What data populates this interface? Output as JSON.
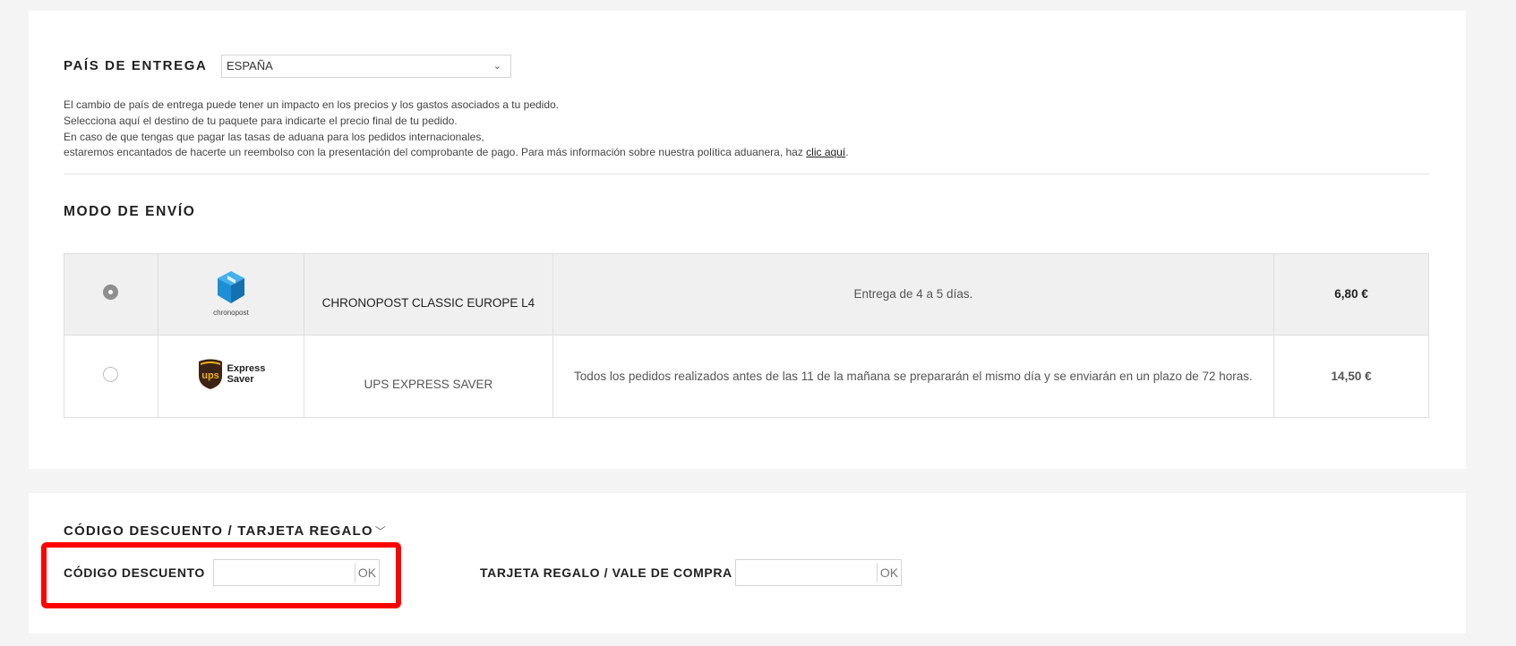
{
  "delivery": {
    "country_label": "PAÍS DE ENTREGA",
    "country_value": "ESPAÑA",
    "info_lines": [
      "El cambio de país de entrega puede tener un impacto en los precios y los gastos asociados a tu pedido.",
      "Selecciona aquí el destino de tu paquete para indicarte el precio final de tu pedido.",
      "En caso de que tengas que pagar las tasas de aduana para los pedidos internacionales,",
      "estaremos encantados de hacerte un reembolso con la presentación del comprobante de pago. Para más información sobre nuestra política aduanera, haz "
    ],
    "info_link": "clic aquí",
    "info_period": "."
  },
  "shipping": {
    "title": "MODO DE ENVÍO",
    "options": [
      {
        "logo_text": "chronopost",
        "name": "CHRONOPOST CLASSIC EUROPE L4",
        "description": "Entrega de 4 a 5 días.",
        "price": "6,80 €",
        "selected": true
      },
      {
        "logo_text_1": "Express",
        "logo_text_2": "Saver",
        "logo_badge": "ups",
        "name": "UPS EXPRESS SAVER",
        "description": "Todos los pedidos realizados antes de las 11 de la mañana se prepararán el mismo día y se enviarán en un plazo de 72 horas.",
        "price": "14,50 €",
        "selected": false
      }
    ]
  },
  "discount": {
    "title": "CÓDIGO DESCUENTO / TARJETA REGALO",
    "code_label": "CÓDIGO DESCUENTO",
    "code_value": "",
    "code_ok": "OK",
    "gift_label": "TARJETA REGALO / VALE DE COMPRA",
    "gift_value": "",
    "gift_ok": "OK"
  },
  "colors": {
    "highlight": "#ff0000",
    "ups_brown": "#3b2415",
    "ups_gold": "#f2b01e",
    "chronopost_blue": "#1e8fd6"
  }
}
